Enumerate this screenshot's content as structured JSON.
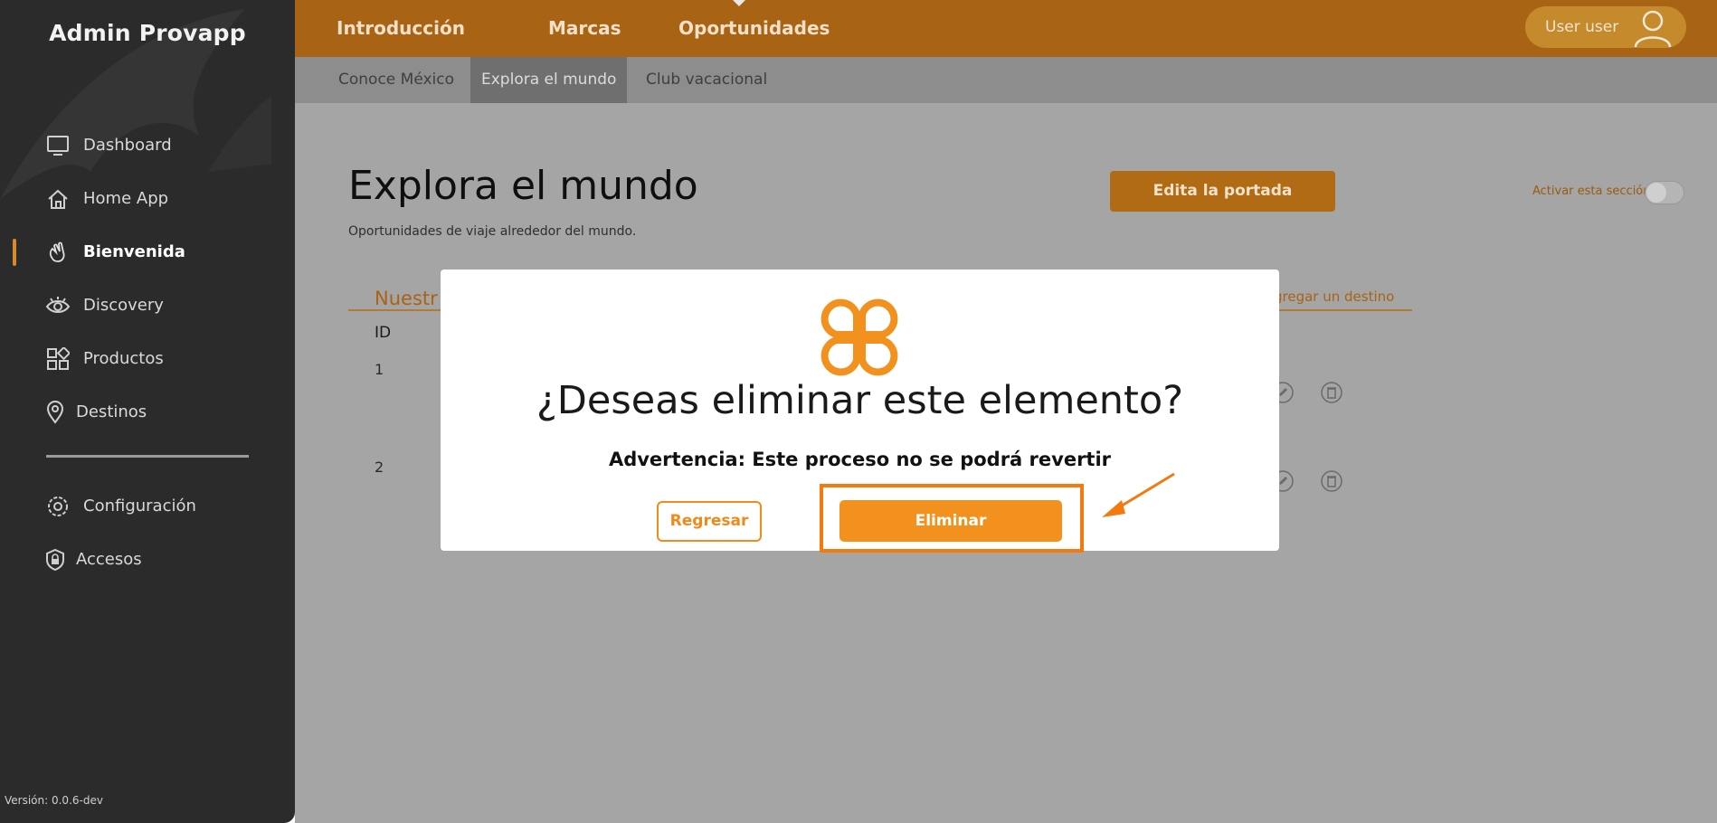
{
  "sidebar": {
    "brand": "Admin Provapp",
    "items": [
      {
        "label": "Dashboard",
        "icon": "monitor-icon"
      },
      {
        "label": "Home App",
        "icon": "home-icon"
      },
      {
        "label": "Bienvenida",
        "icon": "waving-hand-icon",
        "active": true
      },
      {
        "label": "Discovery",
        "icon": "eye-icon"
      },
      {
        "label": "Productos",
        "icon": "grid-icon"
      },
      {
        "label": "Destinos",
        "icon": "location-pin-icon"
      }
    ],
    "bottom_items": [
      {
        "label": "Configuración",
        "icon": "gear-icon"
      },
      {
        "label": "Accesos",
        "icon": "shield-lock-icon"
      }
    ],
    "version": "Versión: 0.0.6-dev"
  },
  "topbar": {
    "nav": [
      "Introducción",
      "Marcas",
      "Oportunidades"
    ],
    "user": "User user",
    "color": "#a86414"
  },
  "subnav": {
    "tabs": [
      "Conoce México",
      "Explora el mundo",
      "Club vacacional"
    ],
    "active": "Explora el mundo"
  },
  "page": {
    "title": "Explora el mundo",
    "subtitle": "Oportunidades de viaje alrededor del mundo.",
    "cover_button": "Edita la portada",
    "toggle_label": "Activar esta sección",
    "section_title": "Nuestr",
    "add_link": "gregar un destino",
    "table": {
      "id_header": "ID",
      "rows": [
        "1",
        "2"
      ]
    }
  },
  "modal": {
    "title": "¿Deseas eliminar este elemento?",
    "warning": "Advertencia: Este proceso no se podrá revertir",
    "back_button": "Regresar",
    "delete_button": "Eliminar",
    "accent": "#f3911f"
  }
}
